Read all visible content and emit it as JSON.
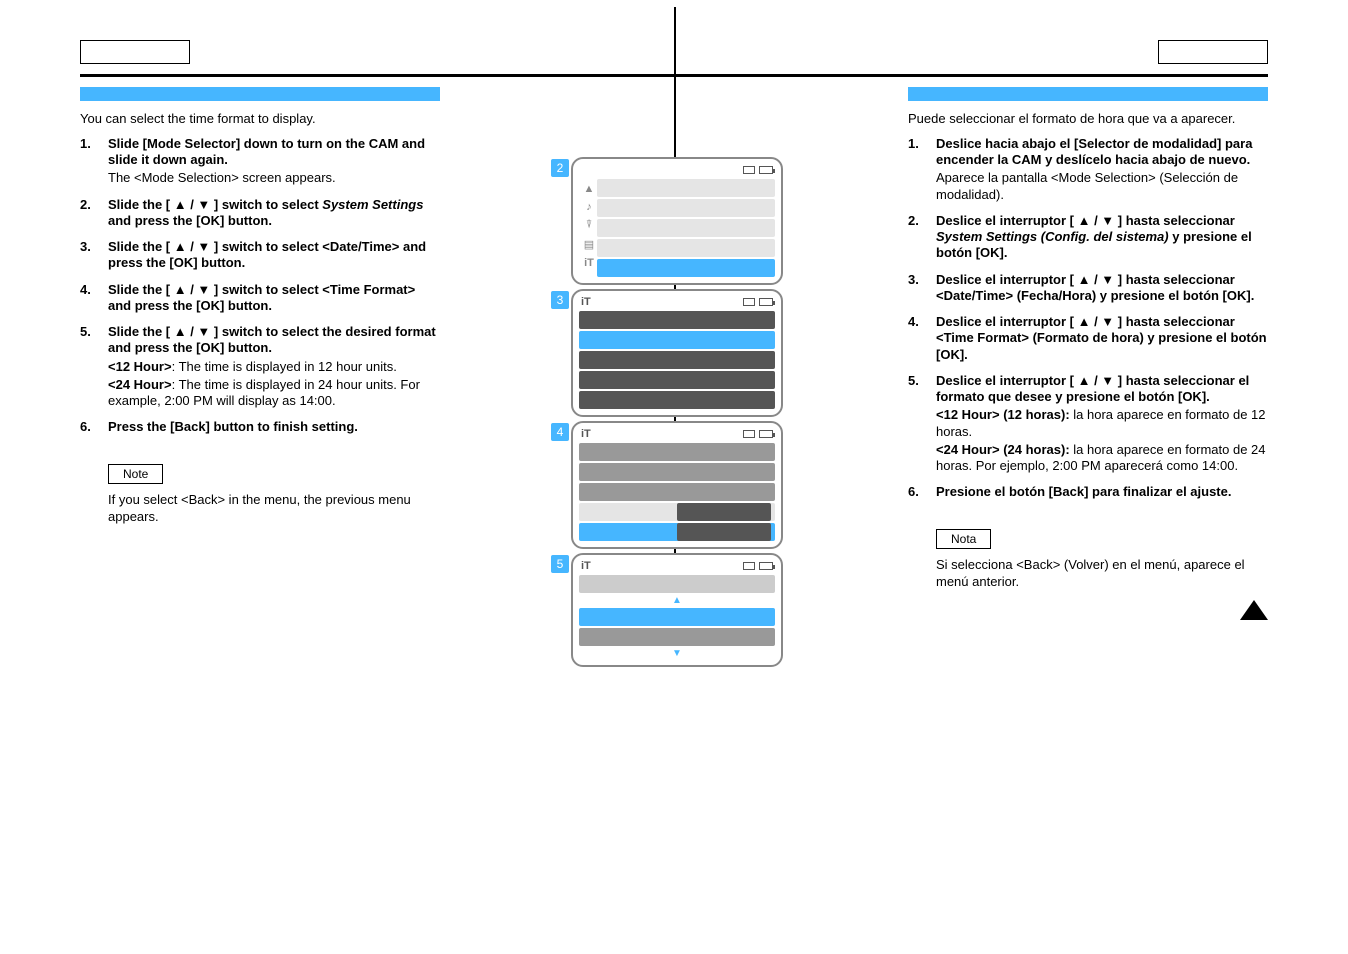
{
  "left": {
    "intro": "You can select the time format to display.",
    "steps": {
      "s1": {
        "num": "1.",
        "bold": "Slide [Mode Selector] down to turn on the CAM and slide it down again.",
        "sub": "The <Mode Selection> screen appears."
      },
      "s2": {
        "num": "2.",
        "bold_a": "Slide the [ ▲ / ▼ ] switch to select ",
        "em": "System Settings",
        "bold_b": " and press the [OK] button."
      },
      "s3": {
        "num": "3.",
        "bold": "Slide the [ ▲ / ▼ ] switch to select <Date/Time> and press the [OK] button."
      },
      "s4": {
        "num": "4.",
        "bold": "Slide the [ ▲ / ▼ ] switch to select <Time Format> and press the [OK] button."
      },
      "s5": {
        "num": "5.",
        "bold": "Slide the [ ▲ / ▼ ] switch to select the desired format and press the [OK] button.",
        "sub_a_b": "<12 Hour>",
        "sub_a": ": The time is displayed in 12 hour units.",
        "sub_b_b": "<24 Hour>",
        "sub_b": ": The time is displayed in 24 hour units. For example, 2:00 PM will display as 14:00."
      },
      "s6": {
        "num": "6.",
        "bold": "Press the [Back] button to finish setting."
      }
    },
    "note_label": "Note",
    "note_text": "If you select <Back> in the menu, the previous menu appears."
  },
  "right": {
    "intro": "Puede seleccionar el formato de hora que va a aparecer.",
    "steps": {
      "s1": {
        "num": "1.",
        "bold": "Deslice hacia abajo el [Selector de modalidad] para encender la CAM y deslícelo hacia abajo de nuevo.",
        "sub": "Aparece la pantalla <Mode Selection> (Selección de modalidad)."
      },
      "s2": {
        "num": "2.",
        "bold_a": "Deslice el interruptor [ ▲ / ▼ ] hasta seleccionar ",
        "em": "System Settings (Config. del sistema)",
        "bold_b": " y presione el botón [OK]."
      },
      "s3": {
        "num": "3.",
        "bold": "Deslice el interruptor [ ▲ / ▼ ] hasta seleccionar <Date/Time> (Fecha/Hora) y presione el botón [OK]."
      },
      "s4": {
        "num": "4.",
        "bold": "Deslice el interruptor [ ▲ / ▼ ] hasta seleccionar <Time Format> (Formato de hora) y presione el botón [OK]."
      },
      "s5": {
        "num": "5.",
        "bold": "Deslice el interruptor [ ▲ / ▼ ] hasta seleccionar el formato que desee y presione el botón [OK].",
        "sub_a_b": "<12 Hour> (12 horas):",
        "sub_a": " la hora aparece en formato de 12 horas.",
        "sub_b_b": "<24 Hour> (24 horas):",
        "sub_b": " la hora aparece en formato de 24 horas. Por ejemplo, 2:00 PM aparecerá como 14:00."
      },
      "s6": {
        "num": "6.",
        "bold": "Presione el botón [Back] para finalizar el ajuste."
      }
    },
    "note_label": "Nota",
    "note_text": "Si selecciona <Back> (Volver) en el menú, aparece el menú anterior."
  },
  "screens": {
    "b2": "2",
    "b3": "3",
    "b4": "4",
    "b5": "5"
  }
}
